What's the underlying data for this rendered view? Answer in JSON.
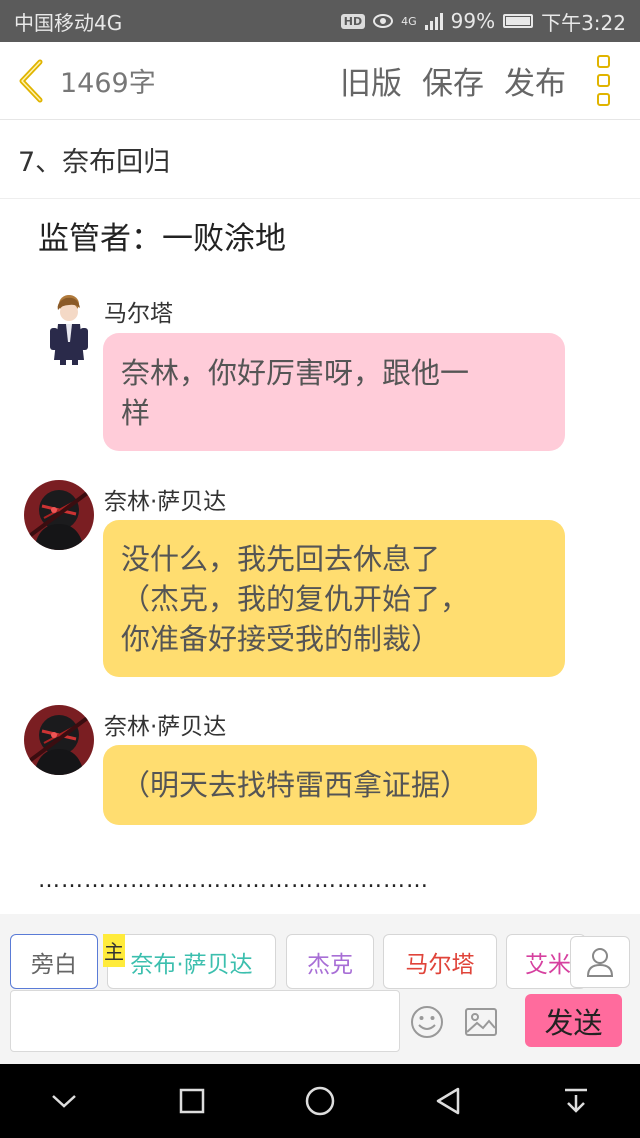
{
  "status": {
    "carrier": "中国移动4G",
    "hd": "HD",
    "network": "4G",
    "battery": "99%",
    "battery_level": 0.99,
    "time": "下午3:22"
  },
  "toolbar": {
    "word_count": "1469字",
    "old_version": "旧版",
    "save": "保存",
    "publish": "发布",
    "accent": "#e0b400"
  },
  "chapter": {
    "title": "7、奈布回归"
  },
  "story": {
    "narration": "监管者：一败涂地",
    "messages": [
      {
        "speaker": "马尔塔",
        "text_line1": "奈林，你好厉害呀，跟他一",
        "text_line2": "样",
        "bubble_color": "#ffccd9"
      },
      {
        "speaker": "奈林·萨贝达",
        "text_line1": "没什么，我先回去休息了",
        "text_line2": "（杰克，我的复仇开始了，",
        "text_line3": "你准备好接受我的制裁）",
        "bubble_color": "#ffdd70"
      },
      {
        "speaker": "奈林·萨贝达",
        "text_line1": "（明天去找特雷西拿证据）",
        "bubble_color": "#ffdd70"
      }
    ],
    "ellipsis": "……………………………………………"
  },
  "composer": {
    "host_tag": "主",
    "characters": [
      {
        "label": "旁白",
        "color": "#666666"
      },
      {
        "label": "奈布·萨贝达",
        "color": "#3cbfae"
      },
      {
        "label": "杰克",
        "color": "#a86fd6"
      },
      {
        "label": "马尔塔",
        "color": "#e0443a"
      },
      {
        "label": "艾米",
        "color": "#d6409f"
      }
    ],
    "input_value": "",
    "send": "发送",
    "send_color": "#ff6b9d"
  }
}
